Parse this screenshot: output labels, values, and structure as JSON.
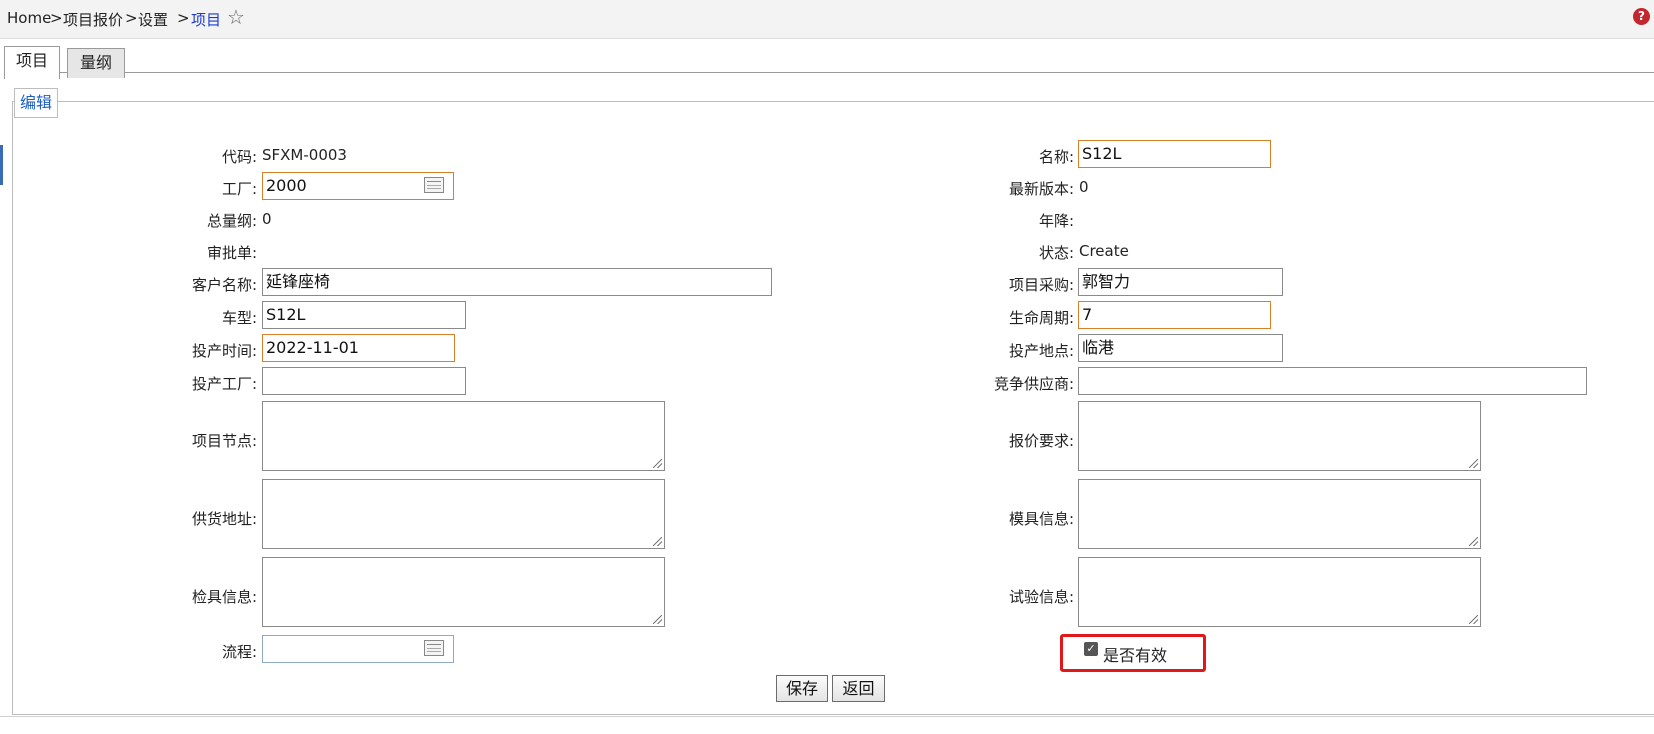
{
  "breadcrumb": {
    "items": [
      "Home",
      "项目报价",
      "设置"
    ],
    "current": "项目",
    "separator": ">"
  },
  "tabs": [
    {
      "label": "项目",
      "active": true
    },
    {
      "label": "量纲",
      "active": false
    }
  ],
  "section_title": "编辑",
  "fields_left": {
    "code": {
      "label": "代码:",
      "value": "SFXM-0003"
    },
    "factory": {
      "label": "工厂:",
      "value": "2000"
    },
    "total": {
      "label": "总量纲:",
      "value": "0"
    },
    "approval": {
      "label": "审批单:",
      "value": ""
    },
    "customer": {
      "label": "客户名称:",
      "value": "延锋座椅"
    },
    "model": {
      "label": "车型:",
      "value": "S12L"
    },
    "production_time": {
      "label": "投产时间:",
      "value": "2022-11-01"
    },
    "production_factory": {
      "label": "投产工厂:",
      "value": ""
    },
    "project_node": {
      "label": "项目节点:",
      "value": ""
    },
    "supply_address": {
      "label": "供货地址:",
      "value": ""
    },
    "inspection_info": {
      "label": "检具信息:",
      "value": ""
    },
    "process": {
      "label": "流程:",
      "value": ""
    }
  },
  "fields_right": {
    "name": {
      "label": "名称:",
      "value": "S12L"
    },
    "latest_version": {
      "label": "最新版本:",
      "value": "0"
    },
    "annual_drop": {
      "label": "年降:",
      "value": ""
    },
    "status": {
      "label": "状态:",
      "value": "Create"
    },
    "purchaser": {
      "label": "项目采购:",
      "value": "郭智力"
    },
    "lifecycle": {
      "label": "生命周期:",
      "value": "7"
    },
    "production_site": {
      "label": "投产地点:",
      "value": "临港"
    },
    "competitor": {
      "label": "竞争供应商:",
      "value": ""
    },
    "quote_requirement": {
      "label": "报价要求:",
      "value": ""
    },
    "mold_info": {
      "label": "模具信息:",
      "value": ""
    },
    "test_info": {
      "label": "试验信息:",
      "value": ""
    }
  },
  "valid_checkbox": {
    "label": "是否有效",
    "checked": true
  },
  "buttons": {
    "save": "保存",
    "back": "返回"
  },
  "colors": {
    "highlight_border": "#e0181a",
    "required_border": "#d97f2a",
    "link": "#1a3bd6"
  }
}
